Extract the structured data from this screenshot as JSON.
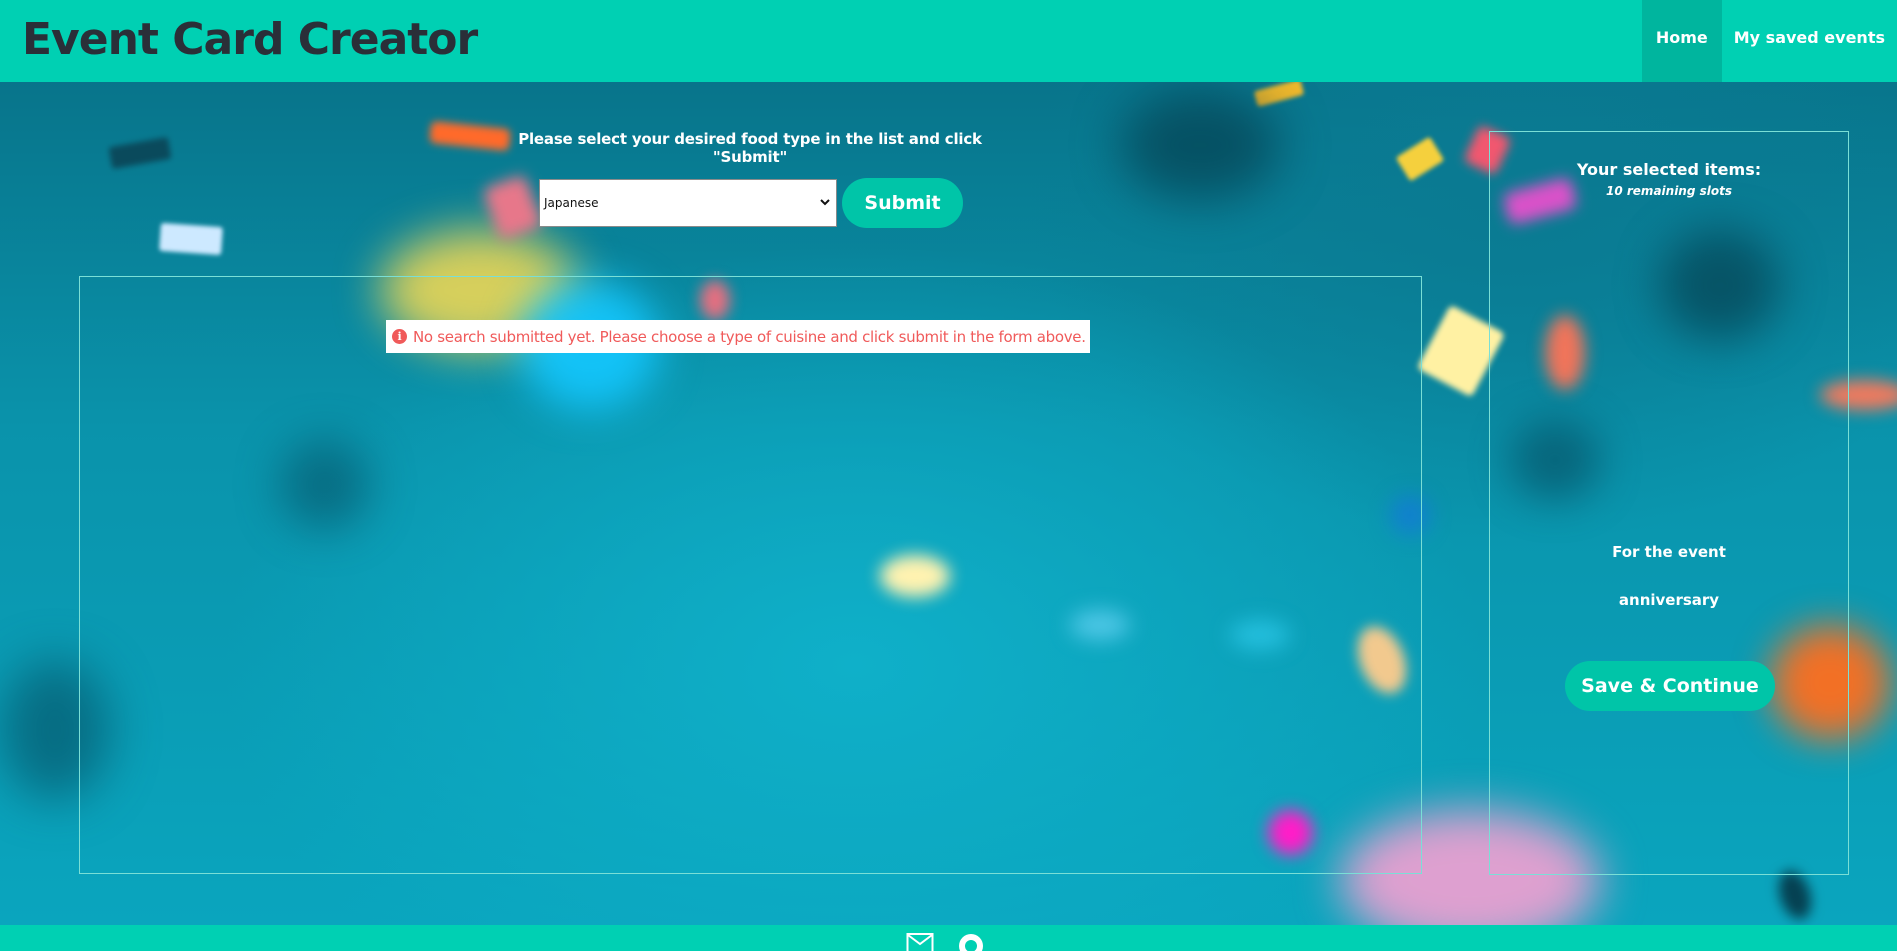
{
  "header": {
    "brand": "Event Card Creator",
    "nav": [
      {
        "label": "Home",
        "active": true
      },
      {
        "label": "My saved events",
        "active": false
      }
    ]
  },
  "search": {
    "instruction": "Please select your desired food type in the list and click \"Submit\"",
    "selected_cuisine": "Japanese",
    "submit_label": "Submit"
  },
  "results": {
    "notice": "No search submitted yet. Please choose a type of cuisine and click submit in the form above."
  },
  "selection": {
    "title": "Your selected items:",
    "remaining": "10 remaining slots",
    "event_label": "For the event",
    "event_name": "anniversary",
    "save_label": "Save & Continue"
  },
  "footer": {
    "icons": [
      "mail-icon",
      "github-icon"
    ]
  },
  "colors": {
    "brand_teal": "#00d0b3",
    "button_teal": "#00c5a8",
    "nav_active": "#00b59e",
    "panel_border": "#7adfd6",
    "notice_red": "#f05a5a",
    "brand_text": "#2a2f38"
  }
}
